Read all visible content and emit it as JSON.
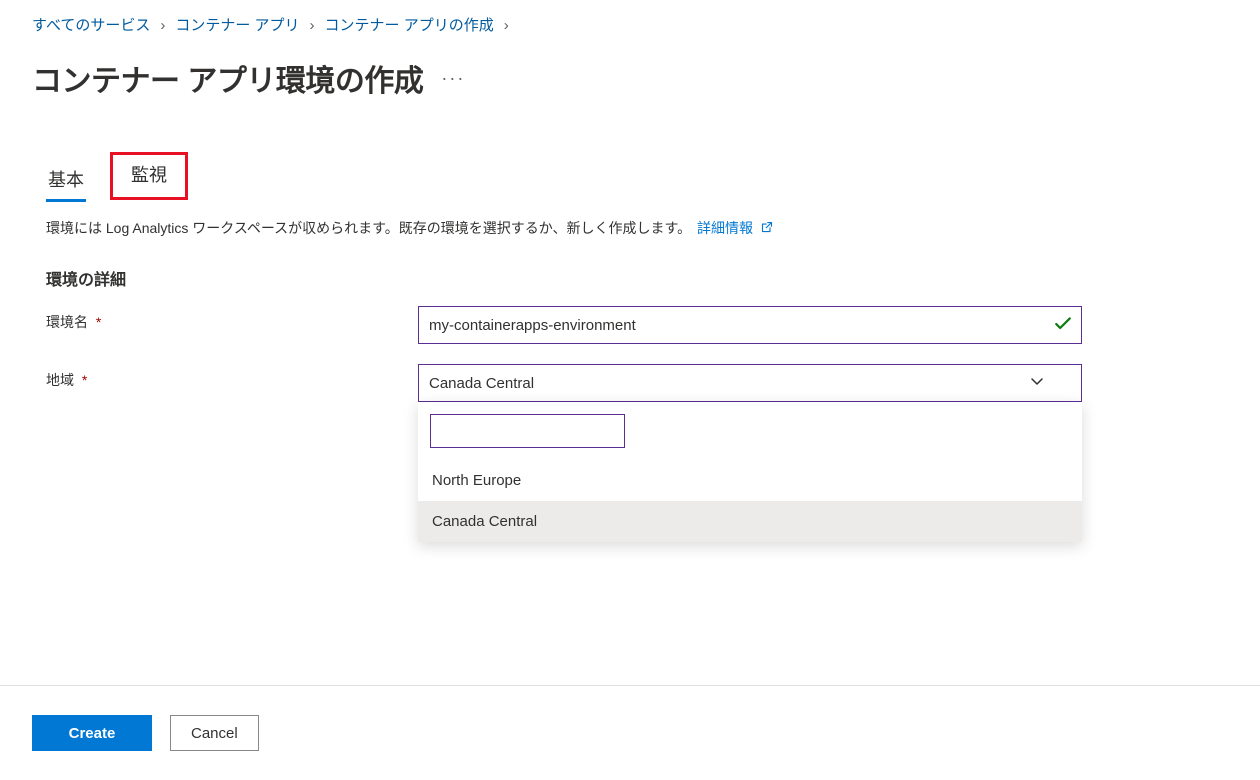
{
  "breadcrumb": {
    "items": [
      {
        "label": "すべてのサービス"
      },
      {
        "label": "コンテナー アプリ"
      },
      {
        "label": "コンテナー アプリの作成"
      }
    ]
  },
  "title": "コンテナー アプリ環境の作成",
  "ellipsis": "···",
  "tabs": {
    "basic": "基本",
    "monitoring": "監視"
  },
  "description_text": "環境には Log Analytics ワークスペースが収められます。既存の環境を選択するか、新しく作成します。",
  "link_more_info": "詳細情報",
  "section_heading": "環境の詳細",
  "form": {
    "env_name_label": "環境名",
    "env_name_value": "my-containerapps-environment",
    "region_label": "地域",
    "region_selected": "Canada Central",
    "region_filter_value": "",
    "region_options": [
      "North Europe",
      "Canada Central"
    ],
    "required_mark": "*"
  },
  "footer": {
    "create": "Create",
    "cancel": "Cancel"
  },
  "icons": {
    "chevron": "›"
  }
}
